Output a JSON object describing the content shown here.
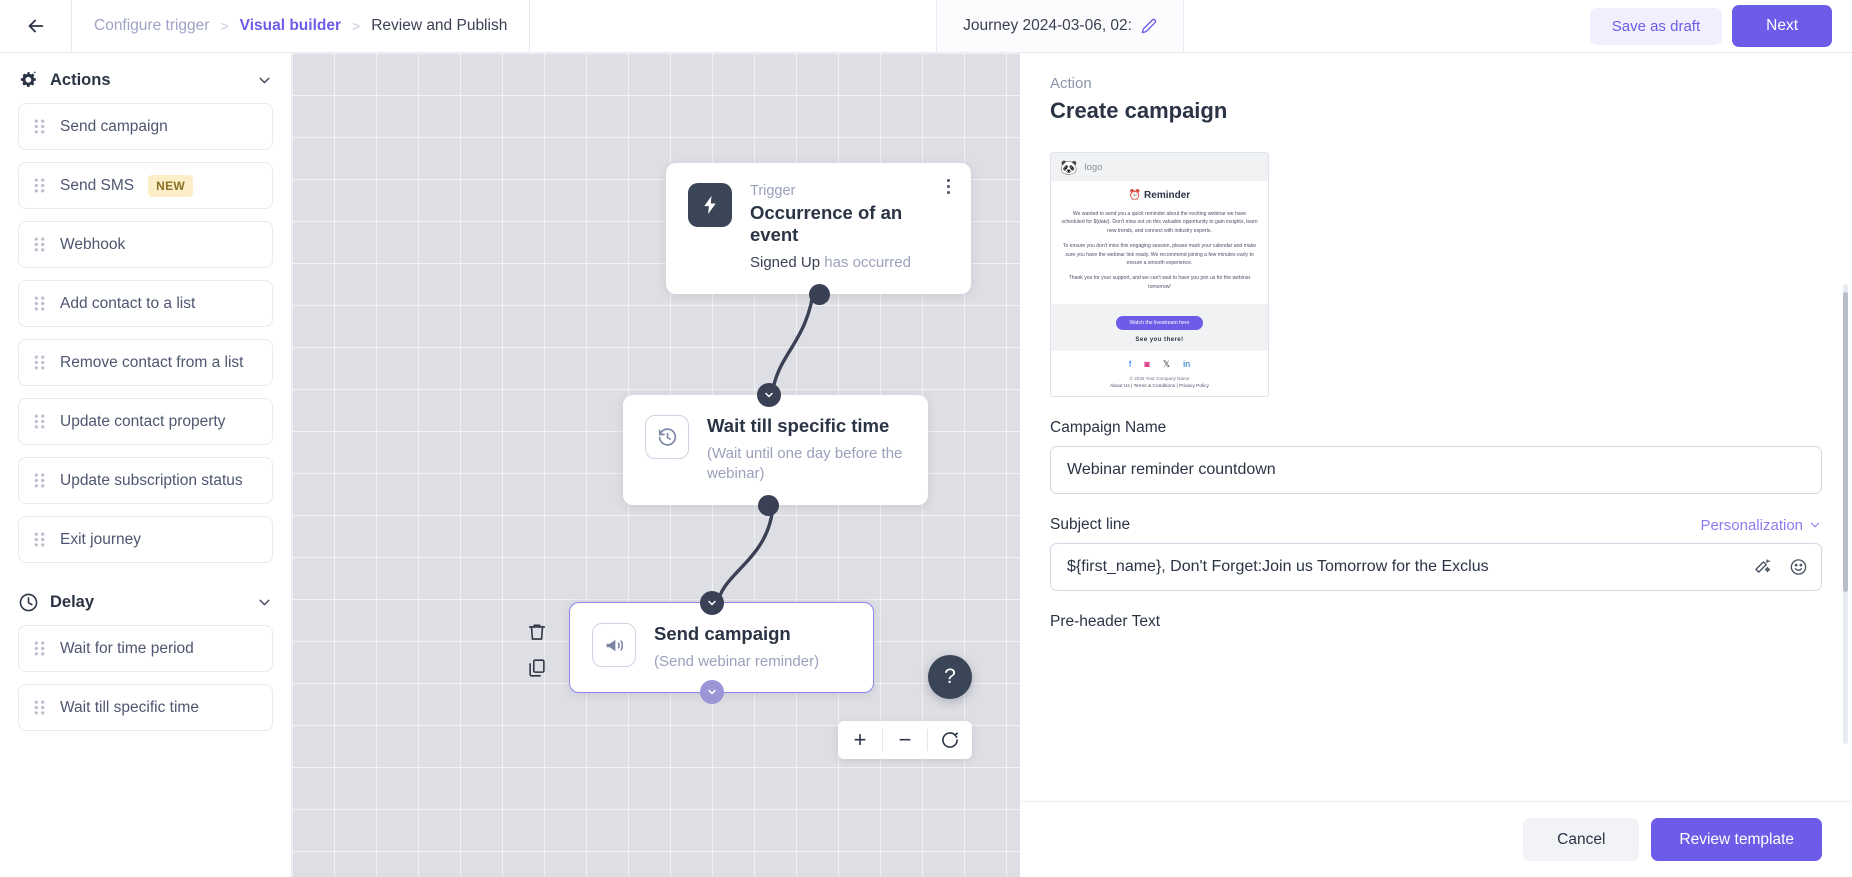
{
  "topbar": {
    "back_icon": "arrow-left-icon",
    "breadcrumb": [
      {
        "label": "Configure trigger",
        "state": "done"
      },
      {
        "label": "Visual builder",
        "state": "active"
      },
      {
        "label": "Review and Publish",
        "state": "upcoming"
      }
    ],
    "separator": ">",
    "journey_title": "Journey 2024-03-06, 02:",
    "edit_icon": "pencil-icon",
    "save_draft_label": "Save as draft",
    "next_label": "Next",
    "accent_color": "#6c5ce7"
  },
  "sidebar": {
    "sections": [
      {
        "title": "Actions",
        "icon": "gear-sparkle-icon",
        "chevron": "chevron-down-icon",
        "items": [
          {
            "label": "Send campaign",
            "badge": ""
          },
          {
            "label": "Send SMS",
            "badge": "NEW"
          },
          {
            "label": "Webhook",
            "badge": ""
          },
          {
            "label": "Add contact to a list",
            "badge": ""
          },
          {
            "label": "Remove contact from a list",
            "badge": ""
          },
          {
            "label": "Update contact property",
            "badge": ""
          },
          {
            "label": "Update subscription status",
            "badge": ""
          },
          {
            "label": "Exit journey",
            "badge": ""
          }
        ]
      },
      {
        "title": "Delay",
        "icon": "clock-icon",
        "chevron": "chevron-down-icon",
        "items": [
          {
            "label": "Wait for time period",
            "badge": ""
          },
          {
            "label": "Wait till specific time",
            "badge": ""
          }
        ]
      }
    ]
  },
  "canvas": {
    "nodes": [
      {
        "kicker": "Trigger",
        "title": "Occurrence of an event",
        "subject": "Signed Up",
        "predicate": "has occurred",
        "icon": "lightning-bolt-icon",
        "menu_icon": "kebab-menu-icon"
      },
      {
        "kicker": "",
        "title": "Wait till specific time",
        "subtitle": "(Wait until one day before the webinar)",
        "icon": "clock-rewind-icon"
      },
      {
        "kicker": "",
        "title": "Send campaign",
        "subtitle": "(Send webinar reminder)",
        "icon": "megaphone-icon",
        "selected": true,
        "tools": [
          "trash-icon",
          "duplicate-icon"
        ]
      }
    ],
    "help_label": "?",
    "zoom_controls": [
      {
        "name": "zoom-in-button",
        "glyph": "+"
      },
      {
        "name": "zoom-out-button",
        "glyph": "−"
      },
      {
        "name": "reset-view-button",
        "glyph": "reset-icon"
      }
    ]
  },
  "panel": {
    "kicker": "Action",
    "title": "Create campaign",
    "preview": {
      "logo_glyph": "🐼",
      "logo_text": "logo",
      "heading": "⏰ Reminder",
      "paragraphs": [
        "We wanted to send you a quick reminder about the exciting webinar we have scheduled for ${date}. Don't miss out on this valuable opportunity to gain insights, learn new trends, and connect with industry experts.",
        "To ensure you don't miss this engaging session, please mark your calendar and make sure you have the webinar link ready. We recommend joining a few minutes early to ensure a smooth experience.",
        "Thank you for your support, and we can't wait to have you join us for the webinar tomorrow!"
      ],
      "cta_label": "Watch the livestream here",
      "signoff": "See you there!",
      "social": [
        "facebook-icon",
        "instagram-icon",
        "x-twitter-icon",
        "linkedin-icon"
      ],
      "copyright": "© 2026 Your Company Name",
      "footer_links": [
        "About Us",
        "Terms & Conditions",
        "Privacy Policy"
      ],
      "footer_sep": "|"
    },
    "fields": {
      "campaign_name_label": "Campaign Name",
      "campaign_name_value": "Webinar reminder countdown",
      "subject_label": "Subject line",
      "personalization_label": "Personalization",
      "personalization_chevron": "chevron-down-icon",
      "subject_value": "${first_name}, Don't Forget:Join us Tomorrow for the Exclus",
      "subject_icons": [
        "magic-wand-icon",
        "emoji-icon"
      ],
      "preheader_label": "Pre-header Text"
    },
    "footer": {
      "cancel_label": "Cancel",
      "review_label": "Review template"
    }
  }
}
